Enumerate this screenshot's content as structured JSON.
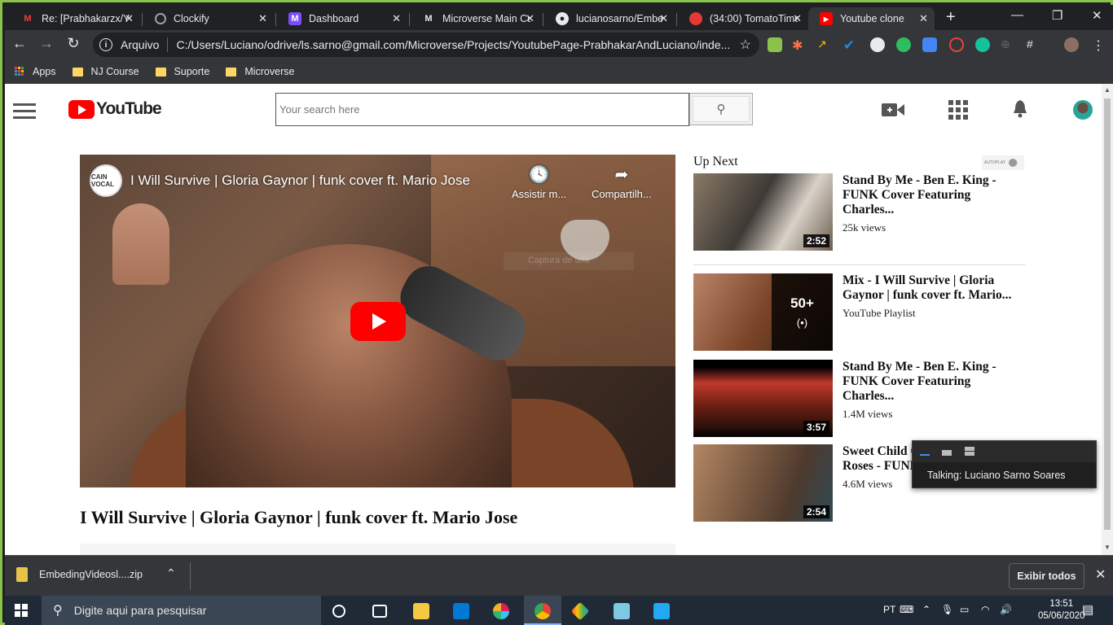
{
  "browser": {
    "tabs": [
      {
        "label": "Re: [Prabhakarzx/Yo",
        "icon": "gmail-icon",
        "color": "#ea4335"
      },
      {
        "label": "Clockify",
        "icon": "clockify-icon",
        "color": "#9aa0a6"
      },
      {
        "label": "Dashboard",
        "icon": "microverse-icon",
        "color": "#7c4dff"
      },
      {
        "label": "Microverse Main Cu",
        "icon": "microverse-icon",
        "color": "#e8eaed"
      },
      {
        "label": "lucianosarno/Embe",
        "icon": "github-icon",
        "color": "#e8eaed"
      },
      {
        "label": "(34:00) TomatoTime",
        "icon": "tomato-icon",
        "color": "#e53935"
      },
      {
        "label": "Youtube clone",
        "icon": "youtube-icon",
        "color": "#ff0000"
      }
    ],
    "omnibox": {
      "protocol": "Arquivo",
      "url": "C:/Users/Luciano/odrive/ls.sarno@gmail.com/Microverse/Projects/YoutubePage-PrabhakarAndLuciano/inde..."
    },
    "bookmarks": [
      "Apps",
      "NJ Course",
      "Suporte",
      "Microverse"
    ]
  },
  "page": {
    "search_placeholder": "Your search here",
    "video": {
      "channel_badge": "CAIN VOCAL",
      "title": "I Will Survive | Gloria Gaynor | funk cover ft. Mario Jose",
      "watch_later": "Assistir m...",
      "share": "Compartilh...",
      "ghost_text": "Captura de tela"
    },
    "main_title": "I Will Survive | Gloria Gaynor | funk cover ft. Mario Jose",
    "upnext": {
      "label": "Up Next",
      "autoplay": "AUTOPLAY",
      "items": [
        {
          "title": "Stand By Me - Ben E. King - FUNK Cover Featuring Charles...",
          "meta": "25k views",
          "duration": "2:52"
        },
        {
          "title": "Mix - I Will Survive | Gloria Gaynor | funk cover ft. Mario...",
          "meta": "YouTube Playlist",
          "count": "50+",
          "playlist_icon": "(•)"
        },
        {
          "title": "Stand By Me - Ben E. King - FUNK Cover Featuring Charles...",
          "meta": "1.4M views",
          "duration": "3:57"
        },
        {
          "title": "Sweet Child O' Mine - Guns N' Roses - FUNK Cover",
          "meta": "4.6M views",
          "duration": "2:54"
        }
      ]
    }
  },
  "talk_popup": {
    "text": "Talking: Luciano Sarno Soares"
  },
  "download_shelf": {
    "file": "EmbedingVideosl....zip",
    "show_all": "Exibir todos"
  },
  "taskbar": {
    "search_placeholder": "Digite aqui para pesquisar",
    "lang": "PT",
    "time": "13:51",
    "date": "05/06/2020"
  }
}
